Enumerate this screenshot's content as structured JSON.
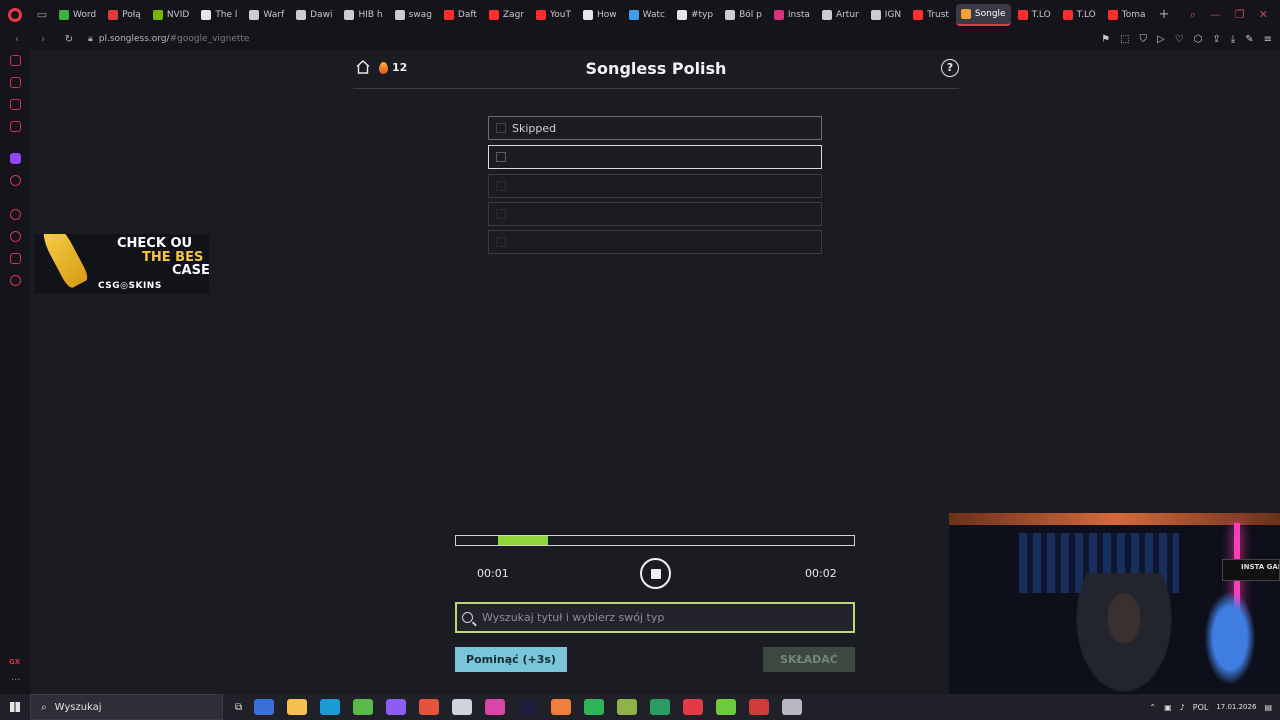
{
  "browser": {
    "tabs": [
      {
        "label": "Word",
        "fav_color": "#3cb043"
      },
      {
        "label": "Połą",
        "fav_color": "#e23b3b"
      },
      {
        "label": "NVID",
        "fav_color": "#76b900"
      },
      {
        "label": "The l",
        "fav_color": "#e6e6e6"
      },
      {
        "label": "Warf",
        "fav_color": "#cccccc"
      },
      {
        "label": "Dawi",
        "fav_color": "#cccccc"
      },
      {
        "label": "HIB h",
        "fav_color": "#cccccc"
      },
      {
        "label": "swag",
        "fav_color": "#cccccc"
      },
      {
        "label": "Daft",
        "fav_color": "#ff2d2d"
      },
      {
        "label": "Zagr",
        "fav_color": "#ff2d2d"
      },
      {
        "label": "YouT",
        "fav_color": "#ff2d2d"
      },
      {
        "label": "How",
        "fav_color": "#e6e6e6"
      },
      {
        "label": "Watc",
        "fav_color": "#3e9cf1"
      },
      {
        "label": "#typ",
        "fav_color": "#e6e6e6"
      },
      {
        "label": "Ból p",
        "fav_color": "#cccccc"
      },
      {
        "label": "Insta",
        "fav_color": "#d6347c"
      },
      {
        "label": "Artur",
        "fav_color": "#cccccc"
      },
      {
        "label": "IGN",
        "fav_color": "#cccccc"
      },
      {
        "label": "Trust",
        "fav_color": "#ff2d2d"
      },
      {
        "label": "Songle",
        "fav_color": "#f4a13a",
        "active": true
      },
      {
        "label": "T.LO",
        "fav_color": "#ff2d2d"
      },
      {
        "label": "T.LO",
        "fav_color": "#ff2d2d"
      },
      {
        "label": "Toma",
        "fav_color": "#ff2d2d"
      }
    ],
    "new_tab": "+",
    "url_host": "pl.songless.org/",
    "url_hash": "#google_vignette"
  },
  "header": {
    "streak": "12",
    "title": "Songless Polish",
    "help": "?"
  },
  "guesses": [
    {
      "label": "Skipped",
      "state": "skipped"
    },
    {
      "label": "",
      "state": "current"
    },
    {
      "label": "",
      "state": "empty"
    },
    {
      "label": "",
      "state": "empty"
    },
    {
      "label": "",
      "state": "empty"
    }
  ],
  "ad": {
    "line1": "CHECK OU",
    "line2": "THE BES",
    "line3": "CASE",
    "brand": "CSG◎SKINS"
  },
  "player": {
    "time_elapsed": "00:01",
    "time_total": "00:02",
    "progress_segment": {
      "start_fraction": 0.105,
      "end_fraction": 0.23
    }
  },
  "search": {
    "placeholder": "Wyszukaj tytuł i wybierz swój typ",
    "value": ""
  },
  "buttons": {
    "skip_label": "Pominąć (+3s)",
    "submit_label": "SKŁADAĆ"
  },
  "webcam": {
    "overlay_text": "INSTA GAMIN"
  },
  "taskbar": {
    "search_label": "Wyszukaj",
    "apps": [
      "#3a6fd8",
      "#f2c14e",
      "#1b9bd6",
      "#5ab94a",
      "#8b5cf6",
      "#e5533d",
      "#cfd3da",
      "#d946a8",
      "#1e1e3c",
      "#f07f3c",
      "#2fb45a",
      "#8fb34a",
      "#2e9c62",
      "#e53949",
      "#6ecb3c",
      "#d23b3b",
      "#b8b8c0"
    ],
    "language": "POL",
    "date": "17.01.2026"
  }
}
